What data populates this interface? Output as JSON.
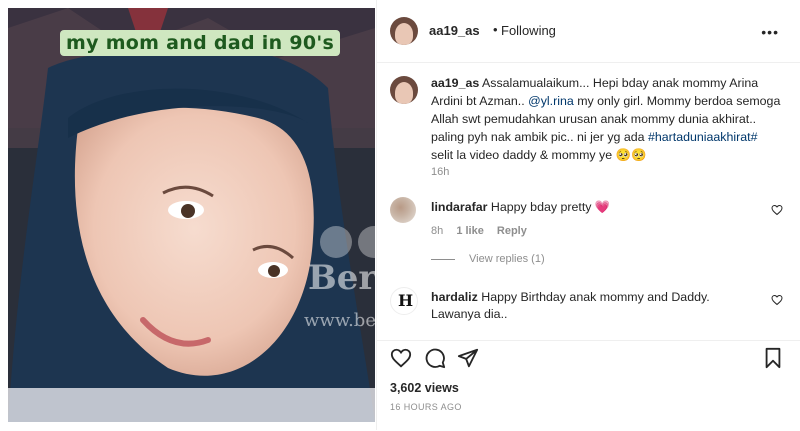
{
  "media": {
    "overlay_text": "my mom and dad in 90's",
    "watermark": "Berita Kopak",
    "watermark_url": "www.beritakopak.com"
  },
  "header": {
    "username": "aa19_as",
    "separator": "•",
    "follow_status": "Following",
    "more_label": "•••"
  },
  "post": {
    "username": "aa19_as",
    "text_before_mention": "Assalamualaikum... Hepi bday anak mommy Arina Ardini bt Azman.. ",
    "mention": "@yl.rina",
    "text_middle": " my only girl. Mommy berdoa semoga Allah swt pemudahkan urusan anak mommy dunia akhirat.. paling pyh nak ambik pic.. ni jer yg ada ",
    "hashtag": "#hartaduniaakhirat#",
    "text_after": " selit la video daddy & mommy ye 🥺🥺",
    "time": "16h"
  },
  "comments": [
    {
      "username": "lindarafar",
      "text": "Happy bday pretty 💗",
      "time": "8h",
      "likes": "1 like",
      "reply": "Reply",
      "view_replies": "View replies (1)"
    },
    {
      "username": "hardaliz",
      "text": "Happy Birthday anak mommy and Daddy. Lawanya dia..",
      "avatar_letter": "H"
    }
  ],
  "footer": {
    "views": "3,602 views",
    "ago": "16 HOURS AGO"
  }
}
